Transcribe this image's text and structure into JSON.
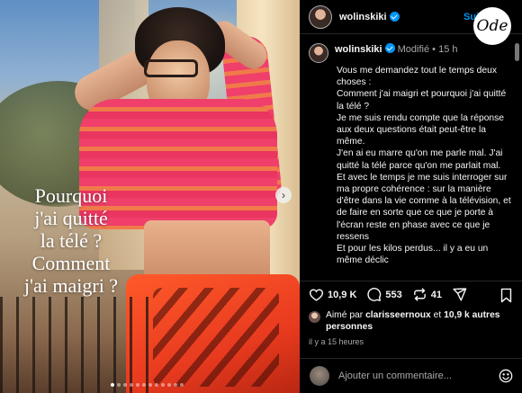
{
  "photo": {
    "overlay_lines": [
      "Pourquoi",
      "j'ai quitté",
      "la télé ?",
      "Comment",
      "j'ai maigri ?"
    ],
    "next_icon": "chevron-right-icon",
    "carousel": {
      "count": 12,
      "active_index": 0
    }
  },
  "header": {
    "username": "wolinskiki",
    "follow_label": "Suivre",
    "logo_text": "Ode"
  },
  "caption": {
    "username": "wolinskiki",
    "edited": "Modifié",
    "separator": "•",
    "age": "15 h",
    "text": "Vous me demandez tout le temps deux choses :\nComment j'ai maigri et pourquoi  j'ai quitté la télé ?\nJe me suis rendu compte que la réponse aux deux questions était peut-être la même.\nJ'en ai eu marre qu'on me parle mal. J'ai quitté la télé parce qu'on me parlait mal.\nEt avec le temps je me suis interroger sur ma propre cohérence : sur la manière d'être dans la vie comme à la télévision, et de faire en sorte que ce que je porte à l'écran reste en phase avec ce que je ressens\nEt pour les kilos perdus... il y a eu un même déclic"
  },
  "actions": {
    "likes": "10,9 K",
    "comments": "553",
    "reposts": "41"
  },
  "liked_by": {
    "prefix": "Aimé par",
    "user": "clarisseernoux",
    "conjunction": "et",
    "others": "10,9 k autres personnes"
  },
  "timestamp": "il y a 15 heures",
  "comment_box": {
    "placeholder": "Ajouter un commentaire..."
  },
  "colors": {
    "accent": "#0095f6",
    "background": "#000000",
    "muted": "#a8a8a8"
  }
}
